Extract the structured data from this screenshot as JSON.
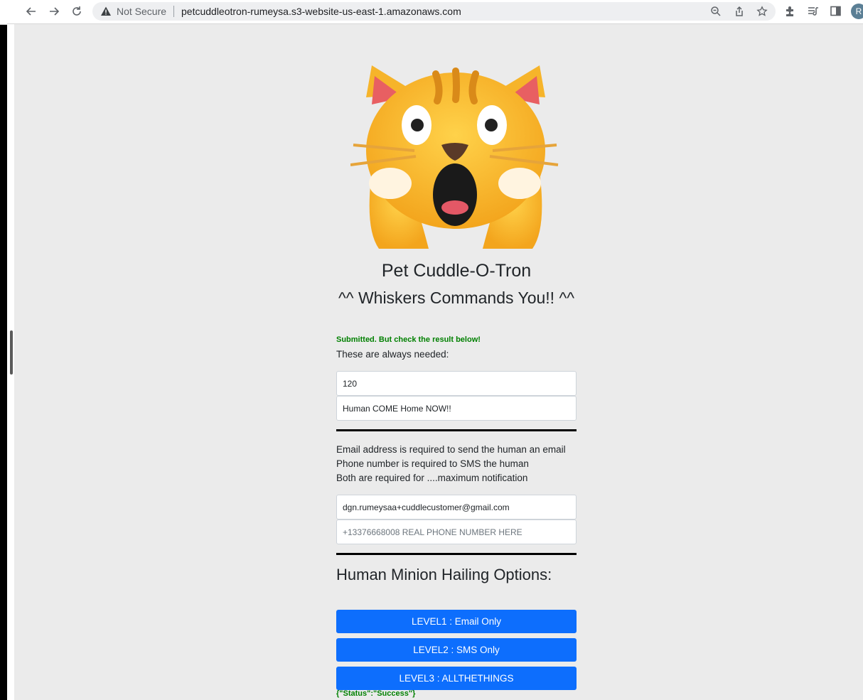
{
  "browser": {
    "security_label": "Not Secure",
    "url": "petcuddleotron-rumeysa.s3-website-us-east-1.amazonaws.com",
    "profile_initial": "R",
    "icons": [
      "back-icon",
      "forward-icon",
      "reload-icon",
      "warning-icon",
      "zoom-icon",
      "share-icon",
      "star-icon",
      "extensions-icon",
      "reading-list-icon",
      "side-panel-icon"
    ]
  },
  "page": {
    "logo": "shocked-cat-emoji",
    "title": "Pet Cuddle-O-Tron",
    "subtitle": "^^ Whiskers Commands You!! ^^",
    "submit_message": "Submitted. But check the result below!",
    "always_needed_label": "These are always needed:",
    "wait_field": {
      "value": "120"
    },
    "message_field": {
      "value": "Human COME Home NOW!!"
    },
    "info_lines": [
      "Email address is required to send the human an email",
      "Phone number is required to SMS the human",
      "Both are required for ....maximum notification"
    ],
    "email_field": {
      "value": "dgn.rumeysaa+cuddlecustomer@gmail.com"
    },
    "phone_field": {
      "placeholder": "+13376668008 REAL PHONE NUMBER HERE"
    },
    "options_heading": "Human Minion Hailing Options:",
    "buttons": {
      "level1": "LEVEL1 : Email Only",
      "level2": "LEVEL2 : SMS Only",
      "level3": "LEVEL3 : ALLTHETHINGS"
    },
    "status_result": "{\"Status\":\"Success\"}"
  },
  "colors": {
    "button": "#0d6efd",
    "success": "#008000",
    "background": "#ebebeb"
  }
}
